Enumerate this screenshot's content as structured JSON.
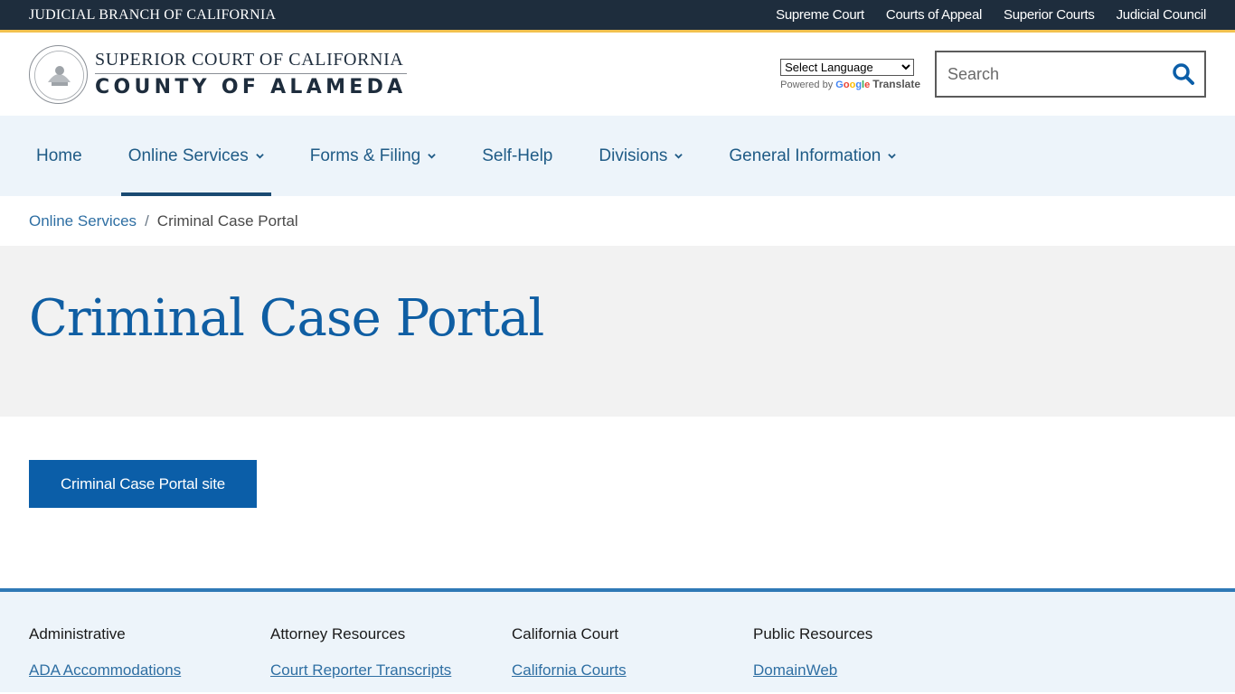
{
  "topbar": {
    "branch_title": "JUDICIAL BRANCH OF CALIFORNIA",
    "links": [
      "Supreme Court",
      "Courts of Appeal",
      "Superior Courts",
      "Judicial Council"
    ]
  },
  "header": {
    "logo_line1": "SUPERIOR COURT OF CALIFORNIA",
    "logo_line2": "COUNTY OF ALAMEDA",
    "seal_label": "JUDICIAL BRANCH OF CALIFORNIA",
    "translate": {
      "selected": "Select Language",
      "powered_by": "Powered by",
      "google": "Google",
      "translate": "Translate"
    },
    "search": {
      "placeholder": "Search",
      "value": ""
    }
  },
  "nav": {
    "items": [
      {
        "label": "Home",
        "dropdown": false,
        "active": false
      },
      {
        "label": "Online Services",
        "dropdown": true,
        "active": true
      },
      {
        "label": "Forms & Filing",
        "dropdown": true,
        "active": false
      },
      {
        "label": "Self-Help",
        "dropdown": false,
        "active": false
      },
      {
        "label": "Divisions",
        "dropdown": true,
        "active": false
      },
      {
        "label": "General Information",
        "dropdown": true,
        "active": false
      }
    ]
  },
  "breadcrumb": {
    "parent": "Online Services",
    "separator": "/",
    "current": "Criminal Case Portal"
  },
  "page": {
    "title": "Criminal Case Portal",
    "button_label": "Criminal Case Portal site"
  },
  "footer": {
    "columns": [
      {
        "heading": "Administrative",
        "link": "ADA Accommodations"
      },
      {
        "heading": "Attorney Resources",
        "link": "Court Reporter Transcripts"
      },
      {
        "heading": "California Court",
        "link": "California Courts"
      },
      {
        "heading": "Public Resources",
        "link": "DomainWeb"
      }
    ]
  },
  "colors": {
    "topbar_bg": "#1e2d3d",
    "topbar_accent": "#f2c14e",
    "nav_bg": "#edf4fa",
    "primary_blue": "#0b5ea8",
    "link_blue": "#2f6fa3"
  }
}
